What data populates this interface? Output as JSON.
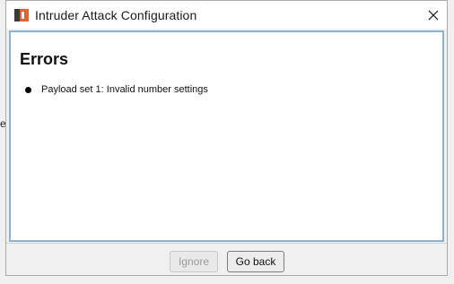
{
  "window": {
    "title": "Intruder Attack Configuration",
    "app_icon": "burp-suite-icon",
    "close_icon": "close-icon"
  },
  "backdrop": {
    "partial_text": "ec"
  },
  "content": {
    "heading": "Errors",
    "errors": [
      "Payload set 1:  Invalid number settings"
    ]
  },
  "footer": {
    "ignore_label": "Ignore",
    "ignore_enabled": false,
    "go_back_label": "Go back"
  },
  "colors": {
    "panel_border": "#8ab2d4",
    "window_bg": "#f0f0f0",
    "icon_orange": "#e8612c",
    "icon_dark": "#3a3a3a"
  }
}
